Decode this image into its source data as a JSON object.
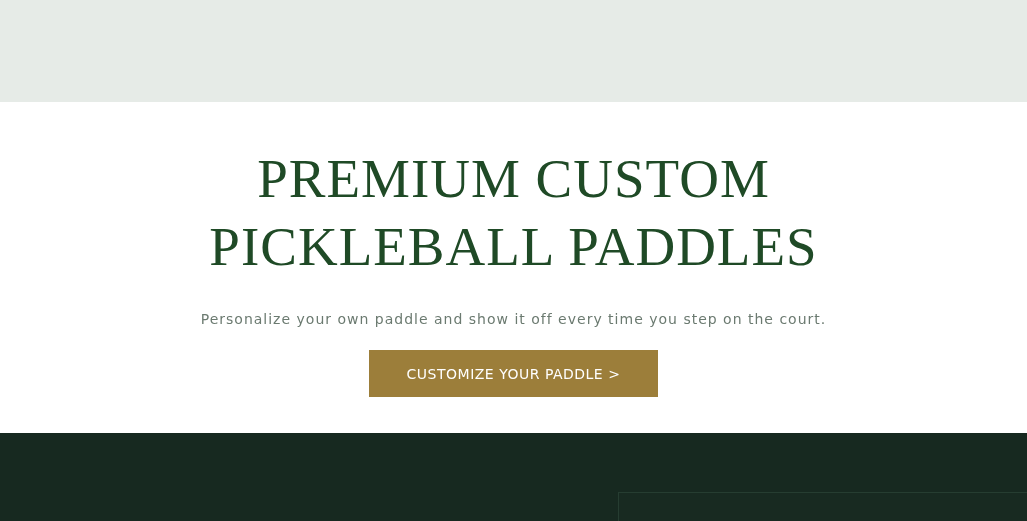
{
  "hero": {
    "heading_lines": [
      "PREMIUM CUSTOM",
      "PICKLEBALL PADDLES"
    ],
    "subtitle": "Personalize your own paddle and show it off every time you step on the court.",
    "button": "CUSTOMIZE YOUR PADDLE >"
  }
}
